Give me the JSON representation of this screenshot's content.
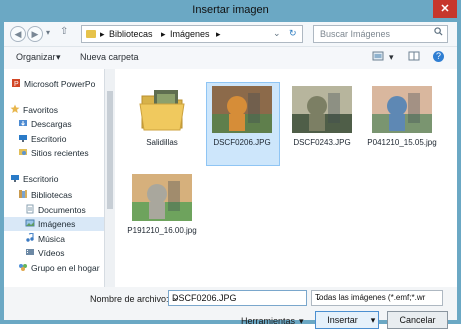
{
  "window": {
    "title": "Insertar imagen",
    "close": "✕"
  },
  "nav": {
    "back": "◀",
    "forward": "▶",
    "recent": "▾",
    "up": "⇧",
    "crumbs": [
      "Bibliotecas",
      "Imágenes"
    ],
    "sep": "▸",
    "dropdown": "⌄",
    "refresh": "↻",
    "search_placeholder": "Buscar Imágenes"
  },
  "toolbar": {
    "organize": "Organizar",
    "organize_dd": "▾",
    "new_folder": "Nueva carpeta",
    "view_dd": "▾",
    "help": "?"
  },
  "sidebar": [
    {
      "label": "Microsoft PowerPo",
      "icon": "powerpoint-icon",
      "indent": 20,
      "selected": false
    },
    {
      "label": "Favoritos",
      "icon": "star-icon",
      "indent": 19,
      "selected": false
    },
    {
      "label": "Descargas",
      "icon": "downloads-icon",
      "indent": 27,
      "selected": false
    },
    {
      "label": "Escritorio",
      "icon": "desktop-icon",
      "indent": 27,
      "selected": false
    },
    {
      "label": "Sitios recientes",
      "icon": "recent-places-icon",
      "indent": 27,
      "selected": false
    },
    {
      "label": "Escritorio",
      "icon": "desktop-icon",
      "indent": 19,
      "selected": false
    },
    {
      "label": "Bibliotecas",
      "icon": "libraries-icon",
      "indent": 27,
      "selected": false
    },
    {
      "label": "Documentos",
      "icon": "documents-icon",
      "indent": 34,
      "selected": false
    },
    {
      "label": "Imágenes",
      "icon": "pictures-icon",
      "indent": 34,
      "selected": true
    },
    {
      "label": "Música",
      "icon": "music-icon",
      "indent": 34,
      "selected": false
    },
    {
      "label": "Vídeos",
      "icon": "videos-icon",
      "indent": 34,
      "selected": false
    },
    {
      "label": "Grupo en el hogar",
      "icon": "homegroup-icon",
      "indent": 27,
      "selected": false
    }
  ],
  "items": [
    {
      "label": "Salidillas",
      "type": "folder",
      "selected": false
    },
    {
      "label": "DSCF0206.JPG",
      "type": "photo",
      "selected": true,
      "colors": [
        "#d68d38",
        "#8c6a4a",
        "#5f7f4c"
      ]
    },
    {
      "label": "DSCF0243.JPG",
      "type": "photo",
      "selected": false,
      "colors": [
        "#7c7f64",
        "#b7b59d",
        "#4f5e48"
      ]
    },
    {
      "label": "P041210_15.05.jpg",
      "type": "photo",
      "selected": false,
      "colors": [
        "#5e88b4",
        "#d9b79e",
        "#7a9570"
      ]
    },
    {
      "label": "P191210_16.00.jpg",
      "type": "photo",
      "selected": false,
      "colors": [
        "#a9a79d",
        "#d6b07c",
        "#6ea35d"
      ]
    }
  ],
  "bottom": {
    "file_label": "Nombre de archivo:",
    "file_value": "DSCF0206.JPG",
    "file_dd": "⌄",
    "filter_value": "Todas las imágenes (*.emf;*.wr",
    "filter_dd": "⌄",
    "tools_label": "Herramientas",
    "tools_dd": "▾",
    "insert_label": "Insertar",
    "insert_dd": "▾",
    "cancel_label": "Cancelar"
  },
  "colors": {
    "accent": "#4b8fd0",
    "selection": "#cde6fb",
    "frame": "#6ba8c4"
  }
}
